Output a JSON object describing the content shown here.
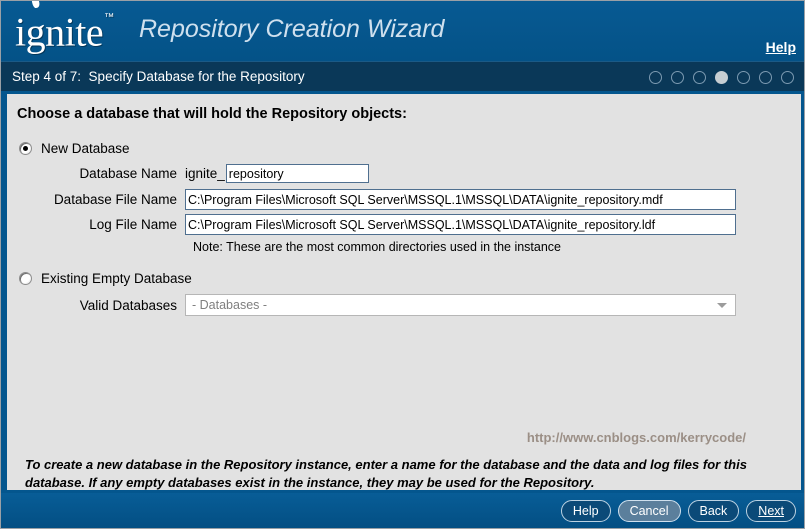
{
  "header": {
    "logo_text": "ignite",
    "logo_tm": "™",
    "app_title": "Repository Creation Wizard",
    "help_label": "Help"
  },
  "stepbar": {
    "step_text": "Step 4 of 7:  Specify Database for the Repository",
    "total_steps": 7,
    "current_step": 4
  },
  "content": {
    "heading": "Choose a database that will hold the Repository objects:",
    "new_database": {
      "radio_label": "New Database",
      "selected": true,
      "fields": {
        "database_name": {
          "label": "Database Name",
          "prefix": "ignite_",
          "value": "repository"
        },
        "database_file_name": {
          "label": "Database File Name",
          "value": "C:\\Program Files\\Microsoft SQL Server\\MSSQL.1\\MSSQL\\DATA\\ignite_repository.mdf"
        },
        "log_file_name": {
          "label": "Log File Name",
          "value": "C:\\Program Files\\Microsoft SQL Server\\MSSQL.1\\MSSQL\\DATA\\ignite_repository.ldf"
        }
      },
      "note": "Note: These are the most common directories used in the instance"
    },
    "existing_database": {
      "radio_label": "Existing Empty Database",
      "selected": false,
      "valid_databases": {
        "label": "Valid Databases",
        "value": "- Databases -"
      }
    },
    "watermark": "http://www.cnblogs.com/kerrycode/",
    "instructions": "To create a new database in the Repository instance, enter a name for the database and the data and log files for this database. If any empty databases exist in the instance, they may be used for the Repository."
  },
  "buttons": {
    "help": "Help",
    "cancel": "Cancel",
    "back": "Back",
    "next": "Next"
  },
  "colors": {
    "header_blue": "#04568e",
    "stepbar_navy": "#0a3858",
    "panel_gray": "#e2e2e2",
    "field_border": "#4f6f8f",
    "active_dot": "#c7ced2"
  }
}
